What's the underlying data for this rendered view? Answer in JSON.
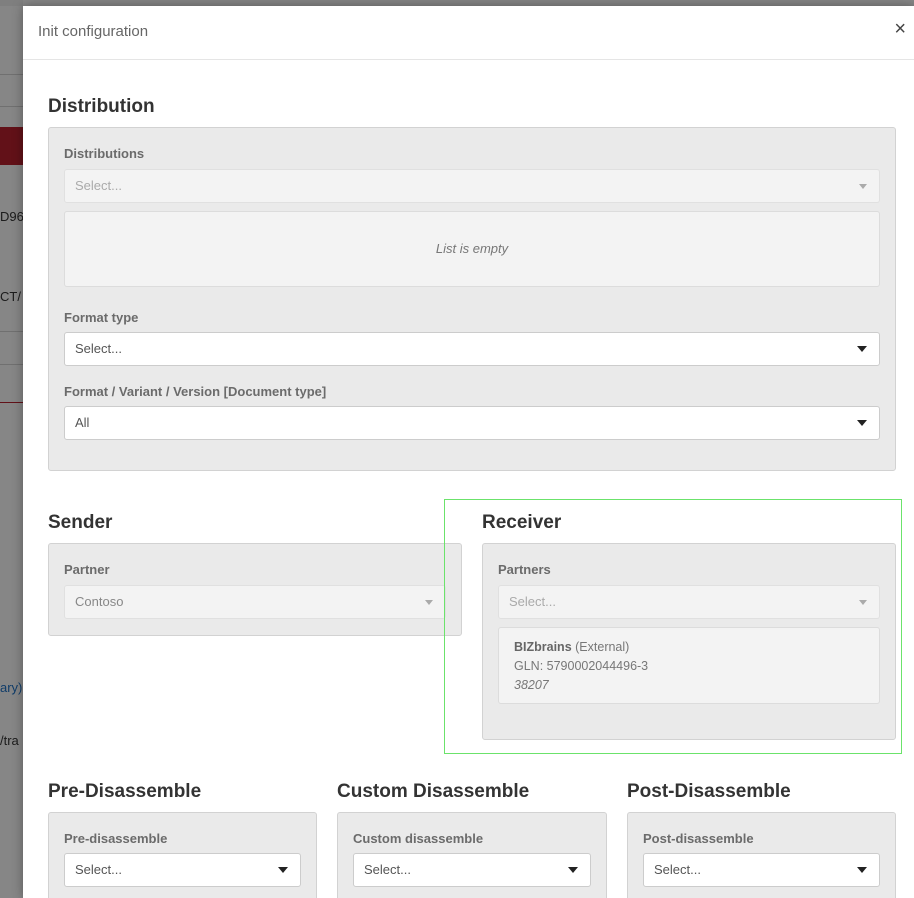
{
  "background": {
    "fragments": [
      "D96/",
      "CT/",
      "ary)",
      "/tra"
    ]
  },
  "modal": {
    "title": "Init configuration",
    "close": "×"
  },
  "distribution": {
    "title": "Distribution",
    "distributions_label": "Distributions",
    "distributions_placeholder": "Select...",
    "empty_text": "List is empty",
    "format_type_label": "Format type",
    "format_type_value": "Select...",
    "format_variant_label": "Format / Variant / Version [Document type]",
    "format_variant_value": "All"
  },
  "sender": {
    "title": "Sender",
    "partner_label": "Partner",
    "partner_value": "Contoso"
  },
  "receiver": {
    "title": "Receiver",
    "partners_label": "Partners",
    "partners_placeholder": "Select...",
    "partner": {
      "name": "BIZbrains",
      "type": "(External)",
      "gln": "GLN: 5790002044496-3",
      "code": "38207"
    }
  },
  "pre_disassemble": {
    "title": "Pre-Disassemble",
    "label": "Pre-disassemble",
    "value": "Select..."
  },
  "custom_disassemble": {
    "title": "Custom Disassemble",
    "label": "Custom disassemble",
    "value": "Select..."
  },
  "post_disassemble": {
    "title": "Post-Disassemble",
    "label": "Post-disassemble",
    "value": "Select..."
  },
  "colors": {
    "highlight": "#6be36b",
    "panel": "#eaeaea",
    "bg_red": "#b3202d",
    "link": "#1f6fbf"
  }
}
